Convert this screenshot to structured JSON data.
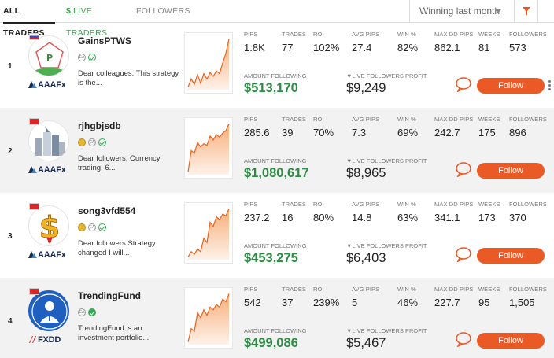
{
  "tabs": {
    "all": "All Traders",
    "live_symbol": "$",
    "live": "Live Traders",
    "followers": "Followers"
  },
  "sort": {
    "value": "Winning last month",
    "icon": "chevron-down-icon"
  },
  "filter": {
    "icon": "filter-icon",
    "color": "#e8541e"
  },
  "colors": {
    "accent": "#ea5a26",
    "amount": "#2e8b45",
    "chart_fill": "#f7a56a",
    "chart_line": "#e8641e"
  },
  "headers": {
    "pips": "PIPS",
    "trades": "TRADES",
    "roi": "ROI",
    "avg_pips": "AVG PIPS",
    "win": "WIN %",
    "max_dd": "MAX DD PIPS",
    "weeks": "WEEKS",
    "followers": "FOLLOWERS",
    "amount_following": "AMOUNT FOLLOWING",
    "live_profit": "▼LIVE FOLLOWERS PROFIT"
  },
  "follow_label": "Follow",
  "traders": [
    {
      "rank": "1",
      "name": "GainsPTWS",
      "description": "Dear colleagues. This strategy is the...",
      "broker": "AAAFx",
      "badges": [
        "ea-icon",
        "verified-check-icon"
      ],
      "pips": "1.8K",
      "trades": "77",
      "roi": "102%",
      "avg_pips": "27.4",
      "win": "82%",
      "max_dd": "862.1",
      "weeks": "81",
      "followers": "573",
      "amount_following": "$513,170",
      "live_profit": "$9,249",
      "equity": [
        0.05,
        0.2,
        0.1,
        0.28,
        0.12,
        0.3,
        0.2,
        0.32,
        0.25,
        0.35,
        0.3,
        0.5,
        0.68,
        0.95
      ]
    },
    {
      "rank": "2",
      "name": "rjhgbjsdb",
      "description": "Dear followers, Currency trading, 6...",
      "broker": "AAAFx",
      "badges": [
        "medal-icon",
        "ea-icon",
        "verified-check-icon"
      ],
      "pips": "285.6",
      "trades": "39",
      "roi": "70%",
      "avg_pips": "7.3",
      "win": "69%",
      "max_dd": "242.7",
      "weeks": "175",
      "followers": "896",
      "amount_following": "$1,080,617",
      "live_profit": "$8,965",
      "equity": [
        0.05,
        0.45,
        0.4,
        0.6,
        0.52,
        0.58,
        0.55,
        0.72,
        0.65,
        0.75,
        0.7,
        0.78,
        0.82,
        0.95
      ]
    },
    {
      "rank": "3",
      "name": "song3vfd554",
      "description": "Dear followers,Strategy changed I will...",
      "broker": "AAAFx",
      "badges": [
        "medal-icon",
        "ea-icon",
        "verified-check-icon"
      ],
      "pips": "237.2",
      "trades": "16",
      "roi": "80%",
      "avg_pips": "14.8",
      "win": "63%",
      "max_dd": "341.1",
      "weeks": "173",
      "followers": "370",
      "amount_following": "$453,275",
      "live_profit": "$6,403",
      "equity": [
        0.05,
        0.15,
        0.1,
        0.2,
        0.15,
        0.4,
        0.32,
        0.7,
        0.62,
        0.8,
        0.75,
        0.85,
        0.82,
        0.95
      ]
    },
    {
      "rank": "4",
      "name": "TrendingFund",
      "description": "TrendingFund is an investment portfolio...",
      "broker": "FXDD",
      "badges": [
        "ea-icon",
        "verified-check-filled-icon"
      ],
      "pips": "542",
      "trades": "37",
      "roi": "239%",
      "avg_pips": "5",
      "win": "46%",
      "max_dd": "227.7",
      "weeks": "95",
      "followers": "1,505",
      "amount_following": "$499,086",
      "live_profit": "$5,467",
      "equity": [
        0.05,
        0.3,
        0.25,
        0.6,
        0.5,
        0.65,
        0.55,
        0.7,
        0.65,
        0.75,
        0.7,
        0.85,
        0.8,
        0.95
      ]
    }
  ]
}
